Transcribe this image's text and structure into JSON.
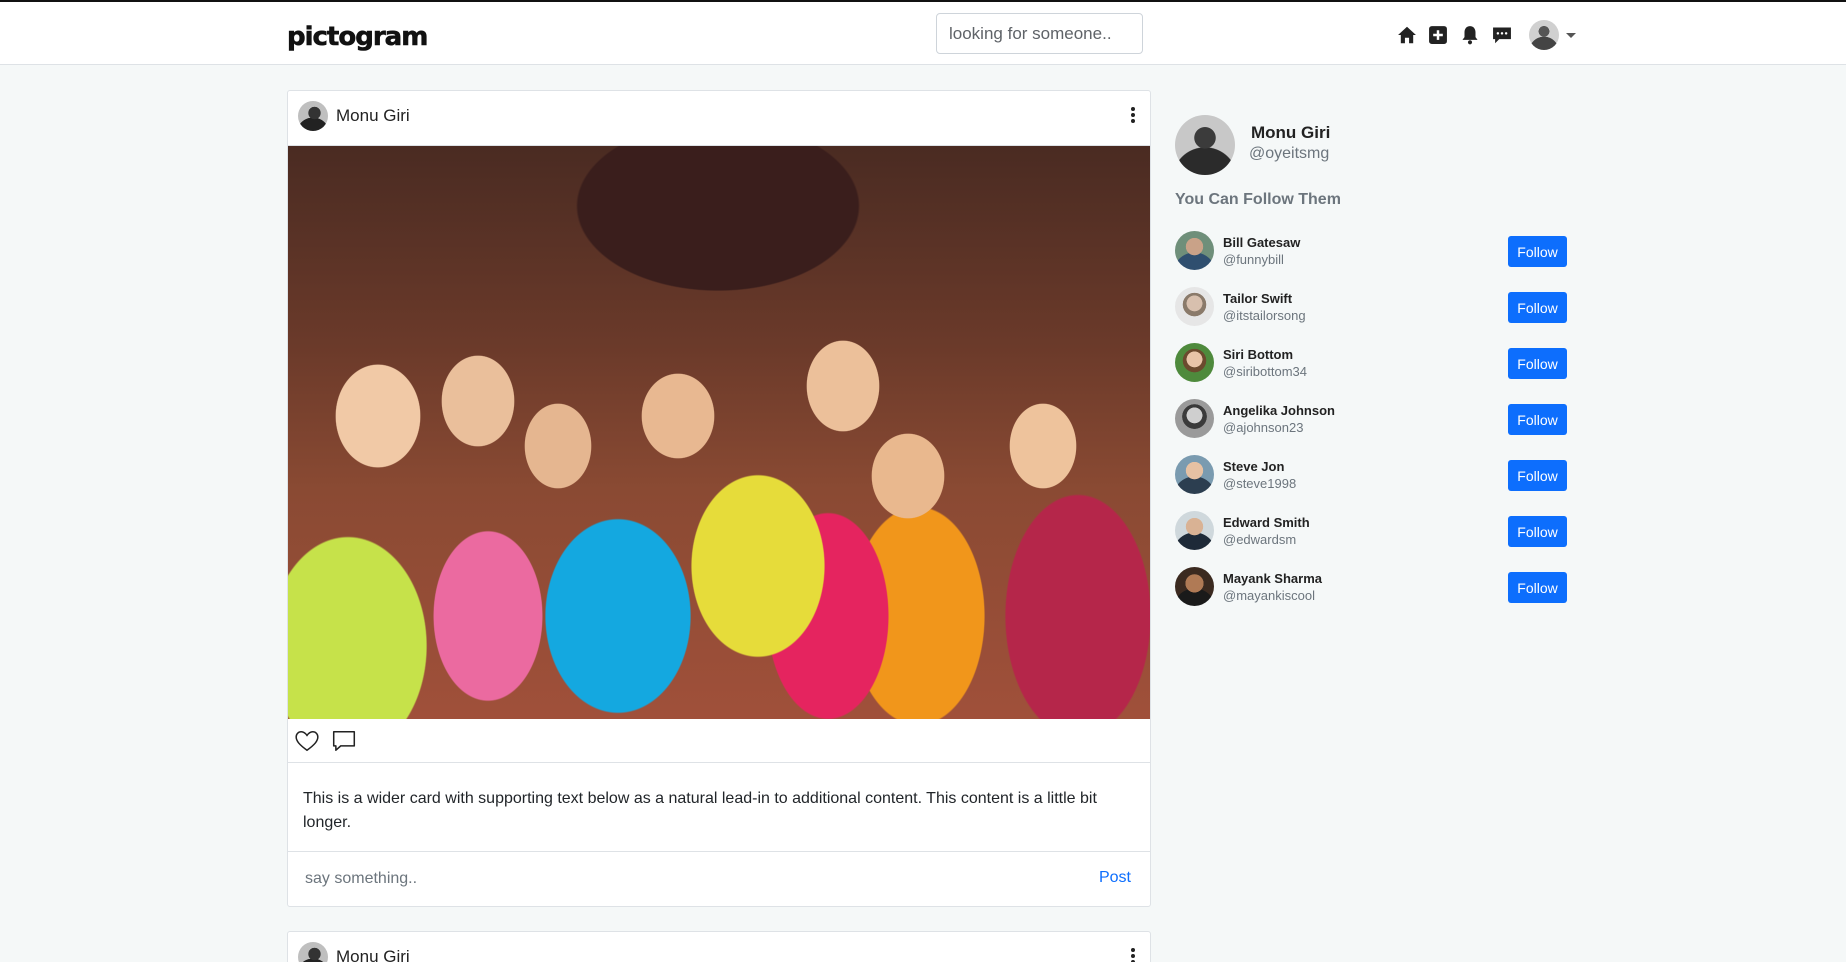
{
  "app": {
    "logo_text": "pictogram"
  },
  "header": {
    "search_placeholder": "looking for someone..",
    "icons": [
      "home-icon",
      "add-post-icon",
      "bell-icon",
      "messages-icon"
    ]
  },
  "post": {
    "author": "Monu Giri",
    "caption": "This is a wider card with supporting text below as a natural lead-in to additional content. This content is a little bit longer.",
    "comment_placeholder": "say something..",
    "post_label": "Post"
  },
  "post2": {
    "author": "Monu Giri"
  },
  "profile": {
    "name": "Monu Giri",
    "handle": "@oyeitsmg"
  },
  "suggestions": {
    "heading": "You Can Follow Them",
    "button_label": "Follow",
    "items": [
      {
        "name": "Bill Gatesaw",
        "handle": "@funnybill"
      },
      {
        "name": "Tailor Swift",
        "handle": "@itstailorsong"
      },
      {
        "name": "Siri Bottom",
        "handle": "@siribottom34"
      },
      {
        "name": "Angelika Johnson",
        "handle": "@ajohnson23"
      },
      {
        "name": "Steve Jon",
        "handle": "@steve1998"
      },
      {
        "name": "Edward Smith",
        "handle": "@edwardsm"
      },
      {
        "name": "Mayank Sharma",
        "handle": "@mayankiscool"
      }
    ]
  },
  "colors": {
    "accent": "#0d6efd",
    "background": "#f5f8f8"
  }
}
